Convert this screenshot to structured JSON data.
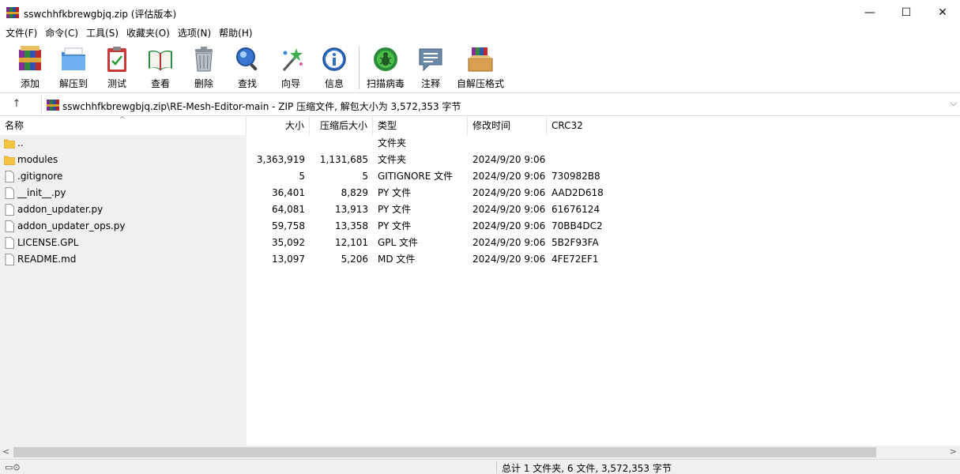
{
  "window": {
    "title": "sswchhfkbrewgbjq.zip (评估版本)",
    "min_glyph": "—",
    "max_glyph": "☐",
    "close_glyph": "✕"
  },
  "menu": [
    "文件(F)",
    "命令(C)",
    "工具(S)",
    "收藏夹(O)",
    "选项(N)",
    "帮助(H)"
  ],
  "toolbar": {
    "add": "添加",
    "extract": "解压到",
    "test": "测试",
    "view": "查看",
    "delete": "删除",
    "find": "查找",
    "wizard": "向导",
    "info": "信息",
    "scan": "扫描病毒",
    "comment": "注释",
    "sfx": "自解压格式"
  },
  "address": {
    "up_glyph": "↑",
    "path": "sswchhfkbrewgbjq.zip\\RE-Mesh-Editor-main - ZIP 压缩文件, 解包大小为 3,572,353 字节",
    "dropdown_glyph": "⌵"
  },
  "columns": {
    "name": "名称",
    "size": "大小",
    "packed": "压缩后大小",
    "type": "类型",
    "modified": "修改时间",
    "crc": "CRC32",
    "sort_glyph": "^"
  },
  "files": [
    {
      "name": "..",
      "size": "",
      "packed": "",
      "type": "文件夹",
      "modified": "",
      "crc": "",
      "kind": "folder"
    },
    {
      "name": "modules",
      "size": "3,363,919",
      "packed": "1,131,685",
      "type": "文件夹",
      "modified": "2024/9/20 9:06",
      "crc": "",
      "kind": "folder"
    },
    {
      "name": ".gitignore",
      "size": "5",
      "packed": "5",
      "type": "GITIGNORE 文件",
      "modified": "2024/9/20 9:06",
      "crc": "730982B8",
      "kind": "file"
    },
    {
      "name": "__init__.py",
      "size": "36,401",
      "packed": "8,829",
      "type": "PY 文件",
      "modified": "2024/9/20 9:06",
      "crc": "AAD2D618",
      "kind": "file"
    },
    {
      "name": "addon_updater.py",
      "size": "64,081",
      "packed": "13,913",
      "type": "PY 文件",
      "modified": "2024/9/20 9:06",
      "crc": "61676124",
      "kind": "file"
    },
    {
      "name": "addon_updater_ops.py",
      "size": "59,758",
      "packed": "13,358",
      "type": "PY 文件",
      "modified": "2024/9/20 9:06",
      "crc": "70BB4DC2",
      "kind": "file"
    },
    {
      "name": "LICENSE.GPL",
      "size": "35,092",
      "packed": "12,101",
      "type": "GPL 文件",
      "modified": "2024/9/20 9:06",
      "crc": "5B2F93FA",
      "kind": "file"
    },
    {
      "name": "README.md",
      "size": "13,097",
      "packed": "5,206",
      "type": "MD 文件",
      "modified": "2024/9/20 9:06",
      "crc": "4FE72EF1",
      "kind": "file"
    }
  ],
  "scroll": {
    "left_glyph": "<",
    "right_glyph": ">"
  },
  "status": {
    "drive_glyph": "▭⊙",
    "text": "总计 1 文件夹, 6 文件, 3,572,353 字节"
  }
}
